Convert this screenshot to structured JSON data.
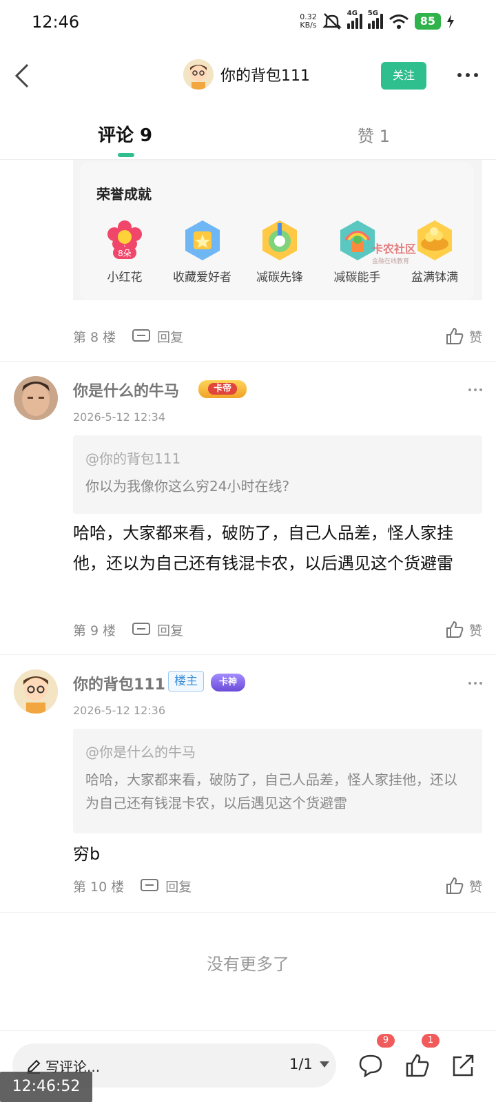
{
  "status_bar": {
    "time": "12:46",
    "net_speed_value": "0.32",
    "net_speed_unit": "KB/s",
    "signal1_gen": "4G",
    "signal2_gen": "5G",
    "battery": "85"
  },
  "nav": {
    "title": "你的背包111",
    "follow_label": "关注"
  },
  "tabs": {
    "comments": "评论 9",
    "likes": "赞 1"
  },
  "honor": {
    "title": "荣誉成就",
    "badges": [
      {
        "label": "小红花",
        "badge_text": "8朵"
      },
      {
        "label": "收藏爱好者"
      },
      {
        "label": "减碳先锋"
      },
      {
        "label": "减碳能手"
      },
      {
        "label": "盆满钵满"
      }
    ],
    "watermark_main": "卡农社区",
    "watermark_sub": "金融在线教育"
  },
  "floors": {
    "floor8": "第 8 楼",
    "floor9": "第 9 楼",
    "floor10": "第 10 楼",
    "reply_label": "回复",
    "like_label": "赞"
  },
  "comments": [
    {
      "name": "你是什么的牛马",
      "title_badge": "卡帝",
      "time": "2026-5-12 12:34",
      "quote_mention": "@你的背包111",
      "quote_text": "你以为我像你这么穷24小时在线?",
      "body": "哈哈，大家都来看，破防了，自己人品差，怪人家挂他，还以为自己还有钱混卡农，以后遇见这个货避雷"
    },
    {
      "name": "你的背包111",
      "owner_tag": "楼主",
      "title_badge": "卡神",
      "time": "2026-5-12 12:36",
      "quote_mention": "@你是什么的牛马",
      "quote_text": "哈哈，大家都来看，破防了，自己人品差，怪人家挂他，还以为自己还有钱混卡农，以后遇见这个货避雷",
      "body": "穷b"
    }
  ],
  "no_more": "没有更多了",
  "bottom_bar": {
    "input_placeholder": "写评论...",
    "pager": "1/1",
    "comment_count": "9",
    "like_count": "1"
  },
  "overlay_time": "12:46:52",
  "colors": {
    "accent": "#2fbf8f",
    "badge_red": "#f15b5b",
    "owner_blue": "#3a8fd8"
  }
}
